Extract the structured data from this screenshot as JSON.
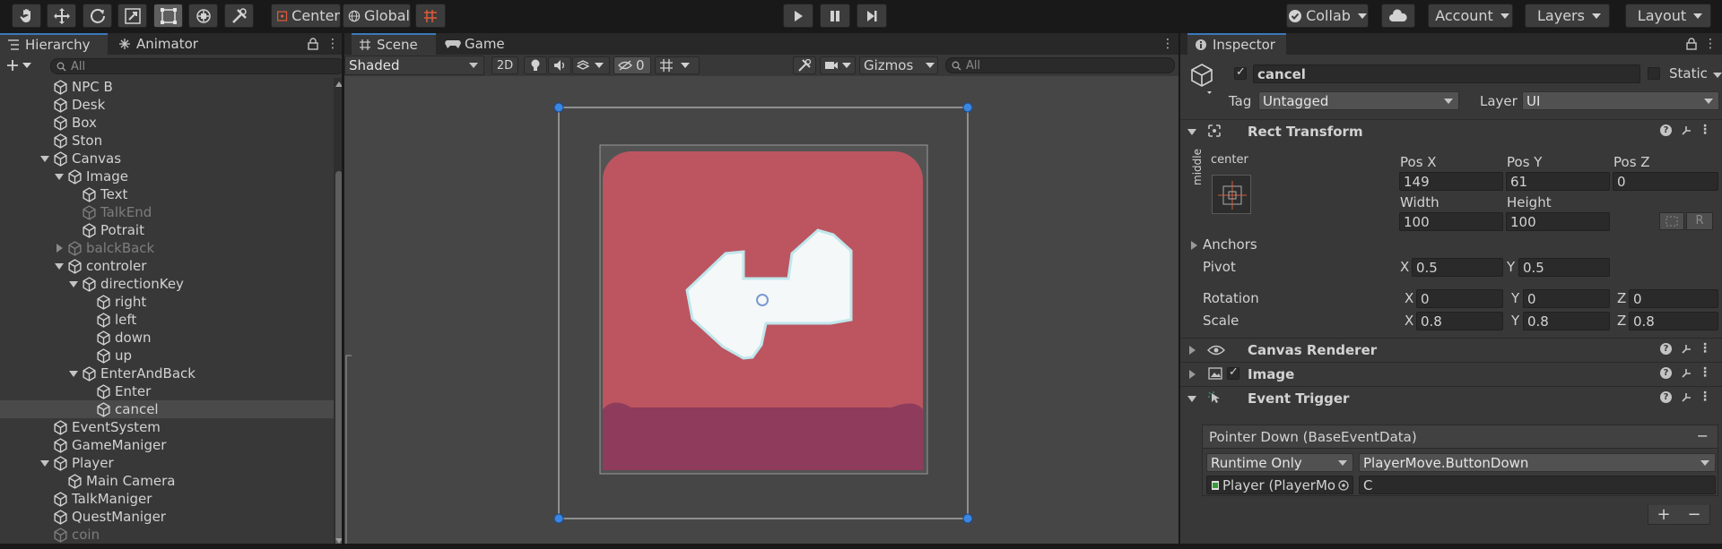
{
  "toolbar": {
    "pivot_label": "Center",
    "space_label": "Global",
    "collab_label": "Collab",
    "account_label": "Account",
    "layers_label": "Layers",
    "layout_label": "Layout"
  },
  "hierarchy": {
    "tab_label": "Hierarchy",
    "animator_tab_label": "Animator",
    "search_placeholder": "All",
    "rows": [
      {
        "label": "NPC B",
        "depth": 1,
        "fold": "none",
        "dim": false,
        "selected": false
      },
      {
        "label": "Desk",
        "depth": 1,
        "fold": "none",
        "dim": false,
        "selected": false
      },
      {
        "label": "Box",
        "depth": 1,
        "fold": "none",
        "dim": false,
        "selected": false
      },
      {
        "label": "Ston",
        "depth": 1,
        "fold": "none",
        "dim": false,
        "selected": false
      },
      {
        "label": "Canvas",
        "depth": 1,
        "fold": "open",
        "dim": false,
        "selected": false
      },
      {
        "label": "Image",
        "depth": 2,
        "fold": "open",
        "dim": false,
        "selected": false
      },
      {
        "label": "Text",
        "depth": 3,
        "fold": "none",
        "dim": false,
        "selected": false
      },
      {
        "label": "TalkEnd",
        "depth": 3,
        "fold": "none",
        "dim": true,
        "selected": false
      },
      {
        "label": "Potrait",
        "depth": 3,
        "fold": "none",
        "dim": false,
        "selected": false
      },
      {
        "label": "balckBack",
        "depth": 2,
        "fold": "closed",
        "dim": true,
        "selected": false
      },
      {
        "label": "controler",
        "depth": 2,
        "fold": "open",
        "dim": false,
        "selected": false
      },
      {
        "label": "directionKey",
        "depth": 3,
        "fold": "open",
        "dim": false,
        "selected": false
      },
      {
        "label": "right",
        "depth": 4,
        "fold": "none",
        "dim": false,
        "selected": false
      },
      {
        "label": "left",
        "depth": 4,
        "fold": "none",
        "dim": false,
        "selected": false
      },
      {
        "label": "down",
        "depth": 4,
        "fold": "none",
        "dim": false,
        "selected": false
      },
      {
        "label": "up",
        "depth": 4,
        "fold": "none",
        "dim": false,
        "selected": false
      },
      {
        "label": "EnterAndBack",
        "depth": 3,
        "fold": "open",
        "dim": false,
        "selected": false
      },
      {
        "label": "Enter",
        "depth": 4,
        "fold": "none",
        "dim": false,
        "selected": false
      },
      {
        "label": "cancel",
        "depth": 4,
        "fold": "none",
        "dim": false,
        "selected": true
      },
      {
        "label": "EventSystem",
        "depth": 1,
        "fold": "none",
        "dim": false,
        "selected": false
      },
      {
        "label": "GameManiger",
        "depth": 1,
        "fold": "none",
        "dim": false,
        "selected": false
      },
      {
        "label": "Player",
        "depth": 1,
        "fold": "open",
        "dim": false,
        "selected": false
      },
      {
        "label": "Main Camera",
        "depth": 2,
        "fold": "none",
        "dim": false,
        "selected": false
      },
      {
        "label": "TalkManiger",
        "depth": 1,
        "fold": "none",
        "dim": false,
        "selected": false
      },
      {
        "label": "QuestManiger",
        "depth": 1,
        "fold": "none",
        "dim": false,
        "selected": false
      },
      {
        "label": "coin",
        "depth": 1,
        "fold": "none",
        "dim": true,
        "selected": false
      }
    ]
  },
  "scene": {
    "tab_label": "Scene",
    "game_tab_label": "Game",
    "draw_mode": "Shaded",
    "mode_2d": "2D",
    "hidden_count": "0",
    "gizmos_label": "Gizmos",
    "search_placeholder": "All"
  },
  "inspector": {
    "tab_label": "Inspector",
    "object_name": "cancel",
    "static_label": "Static",
    "tag_label": "Tag",
    "tag_value": "Untagged",
    "layer_label": "Layer",
    "layer_value": "UI",
    "rect_transform": {
      "title": "Rect Transform",
      "anchor_h": "center",
      "anchor_v": "middle",
      "posx_label": "Pos X",
      "posy_label": "Pos Y",
      "posz_label": "Pos Z",
      "posx": "149",
      "posy": "61",
      "posz": "0",
      "width_label": "Width",
      "height_label": "Height",
      "width": "100",
      "height": "100",
      "raw_btn": "R",
      "anchors_label": "Anchors",
      "pivot_label": "Pivot",
      "pivot_x": "0.5",
      "pivot_y": "0.5",
      "rotation_label": "Rotation",
      "rot_x": "0",
      "rot_y": "0",
      "rot_z": "0",
      "scale_label": "Scale",
      "scale_x": "0.8",
      "scale_y": "0.8",
      "scale_z": "0.8",
      "axis_x": "X",
      "axis_y": "Y",
      "axis_z": "Z"
    },
    "canvas_renderer_title": "Canvas Renderer",
    "image_title": "Image",
    "event_trigger": {
      "title": "Event Trigger",
      "entry_title": "Pointer Down (BaseEventData)",
      "runtime_value": "Runtime Only",
      "function_value": "PlayerMove.ButtonDown",
      "target_value": "Player (PlayerMo",
      "argument_value": "C",
      "remove_symbol": "−",
      "add_symbol": "+",
      "minus_symbol": "−"
    }
  }
}
